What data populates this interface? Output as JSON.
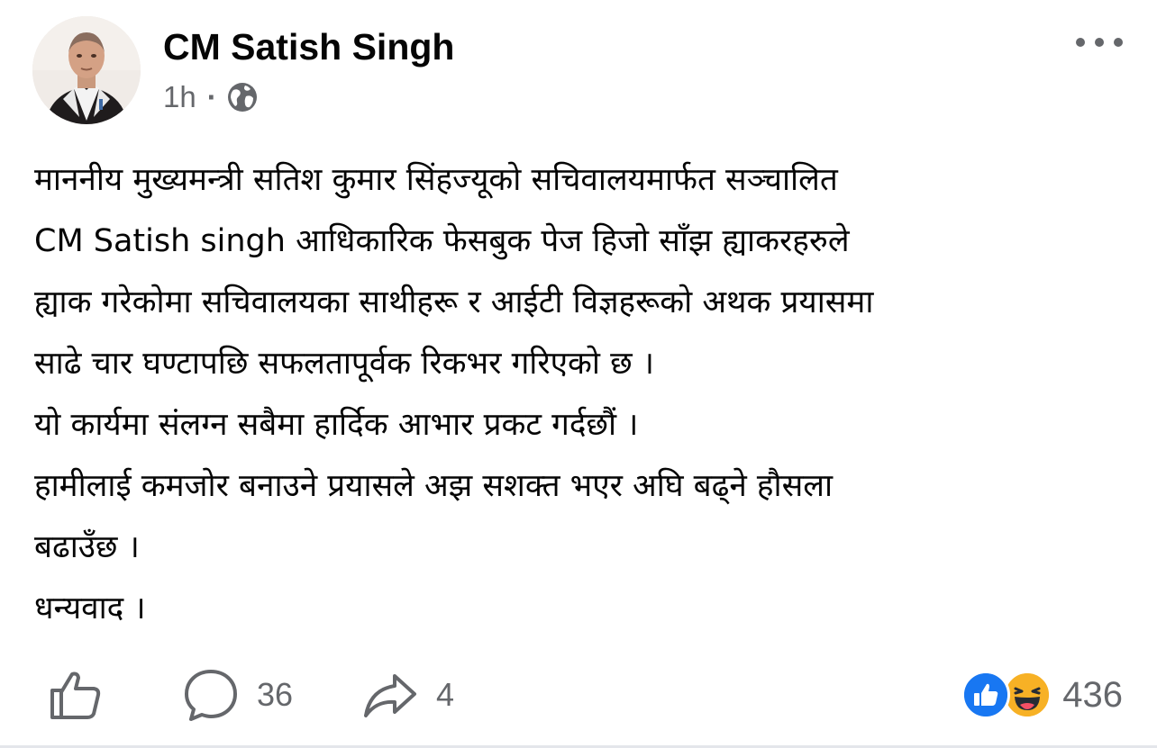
{
  "post": {
    "author": "CM Satish Singh",
    "time": "1h",
    "separator": "·",
    "privacy_icon": "globe-icon",
    "more_icon": "more-horizontal-icon",
    "text_lines": [
      "माननीय मुख्यमन्त्री सतिश कुमार सिंहज्यूको सचिवालयमार्फत सञ्चालित",
      "CM Satish singh आधिकारिक फेसबुक पेज हिजो साँझ ह्याकरहरुले",
      "ह्याक गरेकोमा सचिवालयका साथीहरू र आईटी विज्ञहरूको अथक प्रयासमा",
      "साढे चार घण्टापछि सफलतापूर्वक रिकभर गरिएको छ ।",
      "यो कार्यमा संलग्न सबैमा हार्दिक आभार प्रकट गर्दछौं ।",
      "हामीलाई कमजोर बनाउने प्रयासले अझ सशक्त भएर अघि बढ्ने हौसला",
      "बढाउँछ ।",
      "धन्यवाद ।"
    ]
  },
  "actions": {
    "like_icon": "thumbs-up-icon",
    "comment_icon": "comment-bubble-icon",
    "comment_count": "36",
    "share_icon": "share-arrow-icon",
    "share_count": "4"
  },
  "reactions": {
    "icons": [
      "like-reaction-icon",
      "haha-reaction-icon"
    ],
    "total": "436"
  },
  "colors": {
    "text_primary": "#050505",
    "text_secondary": "#65676b",
    "like_blue": "#1877f2",
    "haha_yellow": "#f7b125"
  }
}
